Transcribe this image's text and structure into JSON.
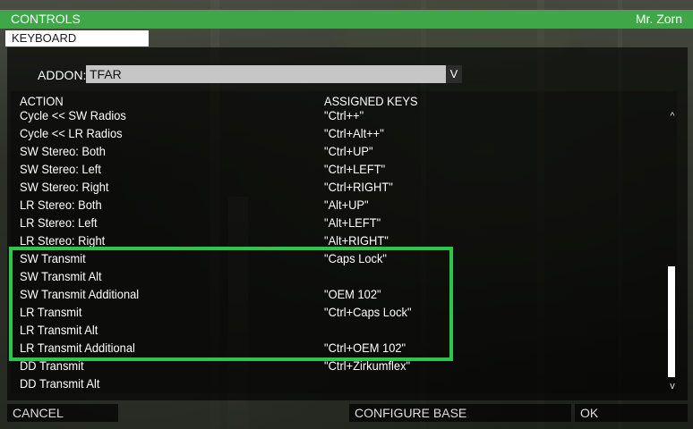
{
  "window": {
    "title": "CONTROLS",
    "user": "Mr. Zorn"
  },
  "tab": {
    "label": "KEYBOARD"
  },
  "addon": {
    "label": "ADDON:",
    "value": "TFAR",
    "chevron": "V"
  },
  "columns": {
    "action": "ACTION",
    "keys": "ASSIGNED KEYS"
  },
  "rows": [
    {
      "action": "Cycle << SW Radios",
      "keys": "\"Ctrl++\""
    },
    {
      "action": "Cycle << LR Radios",
      "keys": "\"Ctrl+Alt++\""
    },
    {
      "action": "SW Stereo: Both",
      "keys": "\"Ctrl+UP\""
    },
    {
      "action": "SW Stereo: Left",
      "keys": "\"Ctrl+LEFT\""
    },
    {
      "action": "SW Stereo: Right",
      "keys": "\"Ctrl+RIGHT\""
    },
    {
      "action": "LR Stereo: Both",
      "keys": "\"Alt+UP\""
    },
    {
      "action": "LR Stereo: Left",
      "keys": "\"Alt+LEFT\""
    },
    {
      "action": "LR Stereo: Right",
      "keys": "\"Alt+RIGHT\""
    },
    {
      "action": "SW Transmit",
      "keys": "\"Caps Lock\""
    },
    {
      "action": "SW Transmit Alt",
      "keys": ""
    },
    {
      "action": "SW Transmit Additional",
      "keys": "\"OEM 102\""
    },
    {
      "action": "LR Transmit",
      "keys": "\"Ctrl+Caps Lock\""
    },
    {
      "action": "LR Transmit Alt",
      "keys": ""
    },
    {
      "action": "LR Transmit Additional",
      "keys": "\"Ctrl+OEM 102\""
    },
    {
      "action": "DD Transmit",
      "keys": "\"Ctrl+Zirkumflex\""
    },
    {
      "action": "DD Transmit Alt",
      "keys": ""
    }
  ],
  "scrollbar": {
    "up": "^",
    "down": "v"
  },
  "buttons": {
    "cancel": "CANCEL",
    "configure_base": "CONFIGURE BASE",
    "ok": "OK"
  },
  "colors": {
    "accent_green": "#3fa748",
    "highlight_green": "#2bc64b"
  }
}
